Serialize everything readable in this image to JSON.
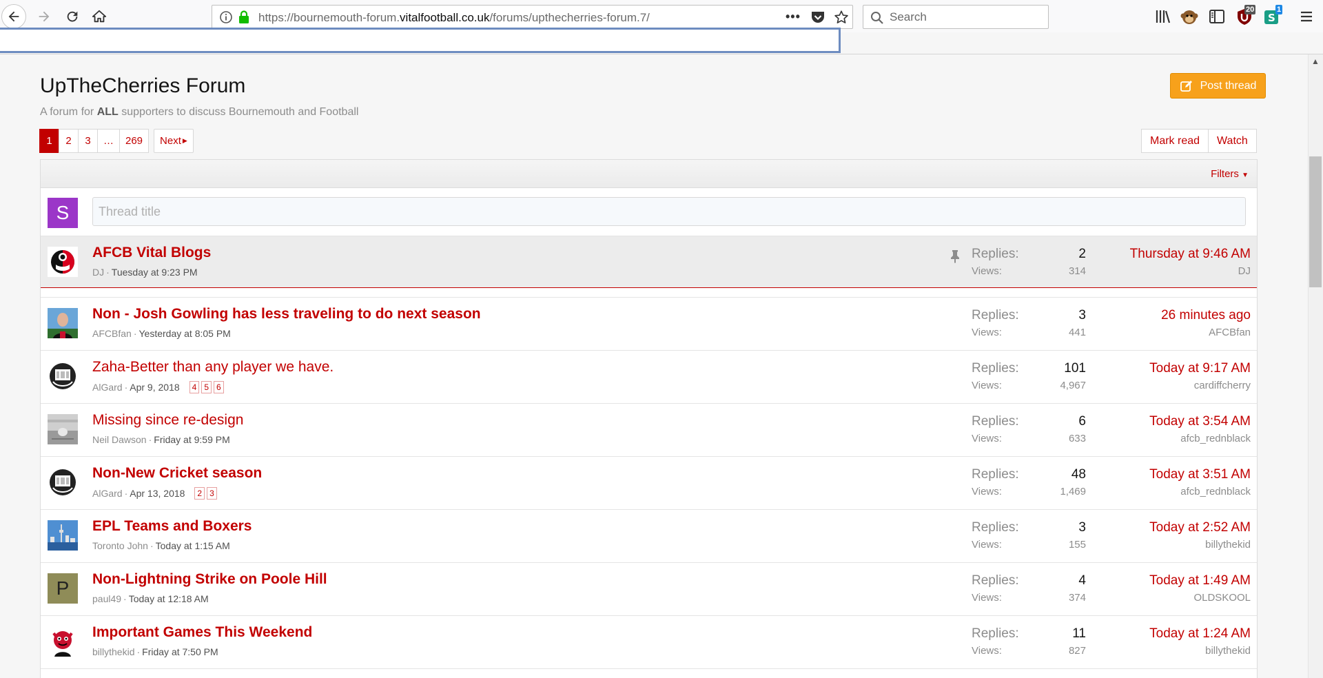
{
  "browser": {
    "url_prefix": "https://bournemouth-forum.",
    "url_domain": "vitalfootball.co.uk",
    "url_path": "/forums/upthecherries-forum.7/",
    "search_placeholder": "Search",
    "badge_ublock": "20",
    "badge_ext": "1",
    "more_label": "•••"
  },
  "forum": {
    "title": "UpTheCherries Forum",
    "desc_before": "A forum for ",
    "desc_bold": "ALL",
    "desc_after": " supporters to discuss Bournemouth and Football",
    "post_thread": "Post thread",
    "mark_read": "Mark read",
    "watch": "Watch",
    "filters": "Filters",
    "thread_title_placeholder": "Thread title",
    "user_initial": "S",
    "replies_label": "Replies:",
    "views_label": "Views:"
  },
  "pagination": {
    "pages": [
      "1",
      "2",
      "3",
      "…",
      "269"
    ],
    "current": "1",
    "next": "Next"
  },
  "threads": [
    {
      "title": "AFCB Vital Blogs",
      "unread": true,
      "sticky": true,
      "author": "DJ",
      "started": "Tuesday at 9:23 PM",
      "pages": [],
      "replies": "2",
      "views": "314",
      "last_date": "Thursday at 9:46 AM",
      "last_user": "DJ",
      "avatar": "afcb-crest"
    },
    {
      "title": "Non - Josh Gowling has less traveling to do next season",
      "unread": true,
      "sticky": false,
      "author": "AFCBfan",
      "started": "Yesterday at 8:05 PM",
      "pages": [],
      "replies": "3",
      "views": "441",
      "last_date": "26 minutes ago",
      "last_user": "AFCBfan",
      "avatar": "player-photo"
    },
    {
      "title": "Zaha-Better than any player we have.",
      "unread": false,
      "sticky": false,
      "author": "AlGard",
      "started": "Apr 9, 2018",
      "pages": [
        "4",
        "5",
        "6"
      ],
      "replies": "101",
      "views": "4,967",
      "last_date": "Today at 9:17 AM",
      "last_user": "cardiffcherry",
      "avatar": "ace-cards"
    },
    {
      "title": "Missing since re-design",
      "unread": false,
      "sticky": false,
      "author": "Neil Dawson",
      "started": "Friday at 9:59 PM",
      "pages": [],
      "replies": "6",
      "views": "633",
      "last_date": "Today at 3:54 AM",
      "last_user": "afcb_rednblack",
      "avatar": "grey-photo"
    },
    {
      "title": "Non-New Cricket season",
      "unread": true,
      "sticky": false,
      "author": "AlGard",
      "started": "Apr 13, 2018",
      "pages": [
        "2",
        "3"
      ],
      "replies": "48",
      "views": "1,469",
      "last_date": "Today at 3:51 AM",
      "last_user": "afcb_rednblack",
      "avatar": "ace-cards"
    },
    {
      "title": "EPL Teams and Boxers",
      "unread": true,
      "sticky": false,
      "author": "Toronto John",
      "started": "Today at 1:15 AM",
      "pages": [],
      "replies": "3",
      "views": "155",
      "last_date": "Today at 2:52 AM",
      "last_user": "billythekid",
      "avatar": "city-skyline"
    },
    {
      "title": "Non-Lightning Strike on Poole Hill",
      "unread": true,
      "sticky": false,
      "author": "paul49",
      "started": "Today at 12:18 AM",
      "pages": [],
      "replies": "4",
      "views": "374",
      "last_date": "Today at 1:49 AM",
      "last_user": "OLDSKOOL",
      "avatar": "letter-p",
      "initial": "P"
    },
    {
      "title": "Important Games This Weekend",
      "unread": true,
      "sticky": false,
      "author": "billythekid",
      "started": "Friday at 7:50 PM",
      "pages": [],
      "replies": "11",
      "views": "827",
      "last_date": "Today at 1:24 AM",
      "last_user": "billythekid",
      "avatar": "cartoon-devil"
    }
  ],
  "colors": {
    "accent": "#c20000",
    "post_button": "#f7a11b",
    "user_avatar": "#9b36c8",
    "p_avatar": "#8f8c58"
  }
}
